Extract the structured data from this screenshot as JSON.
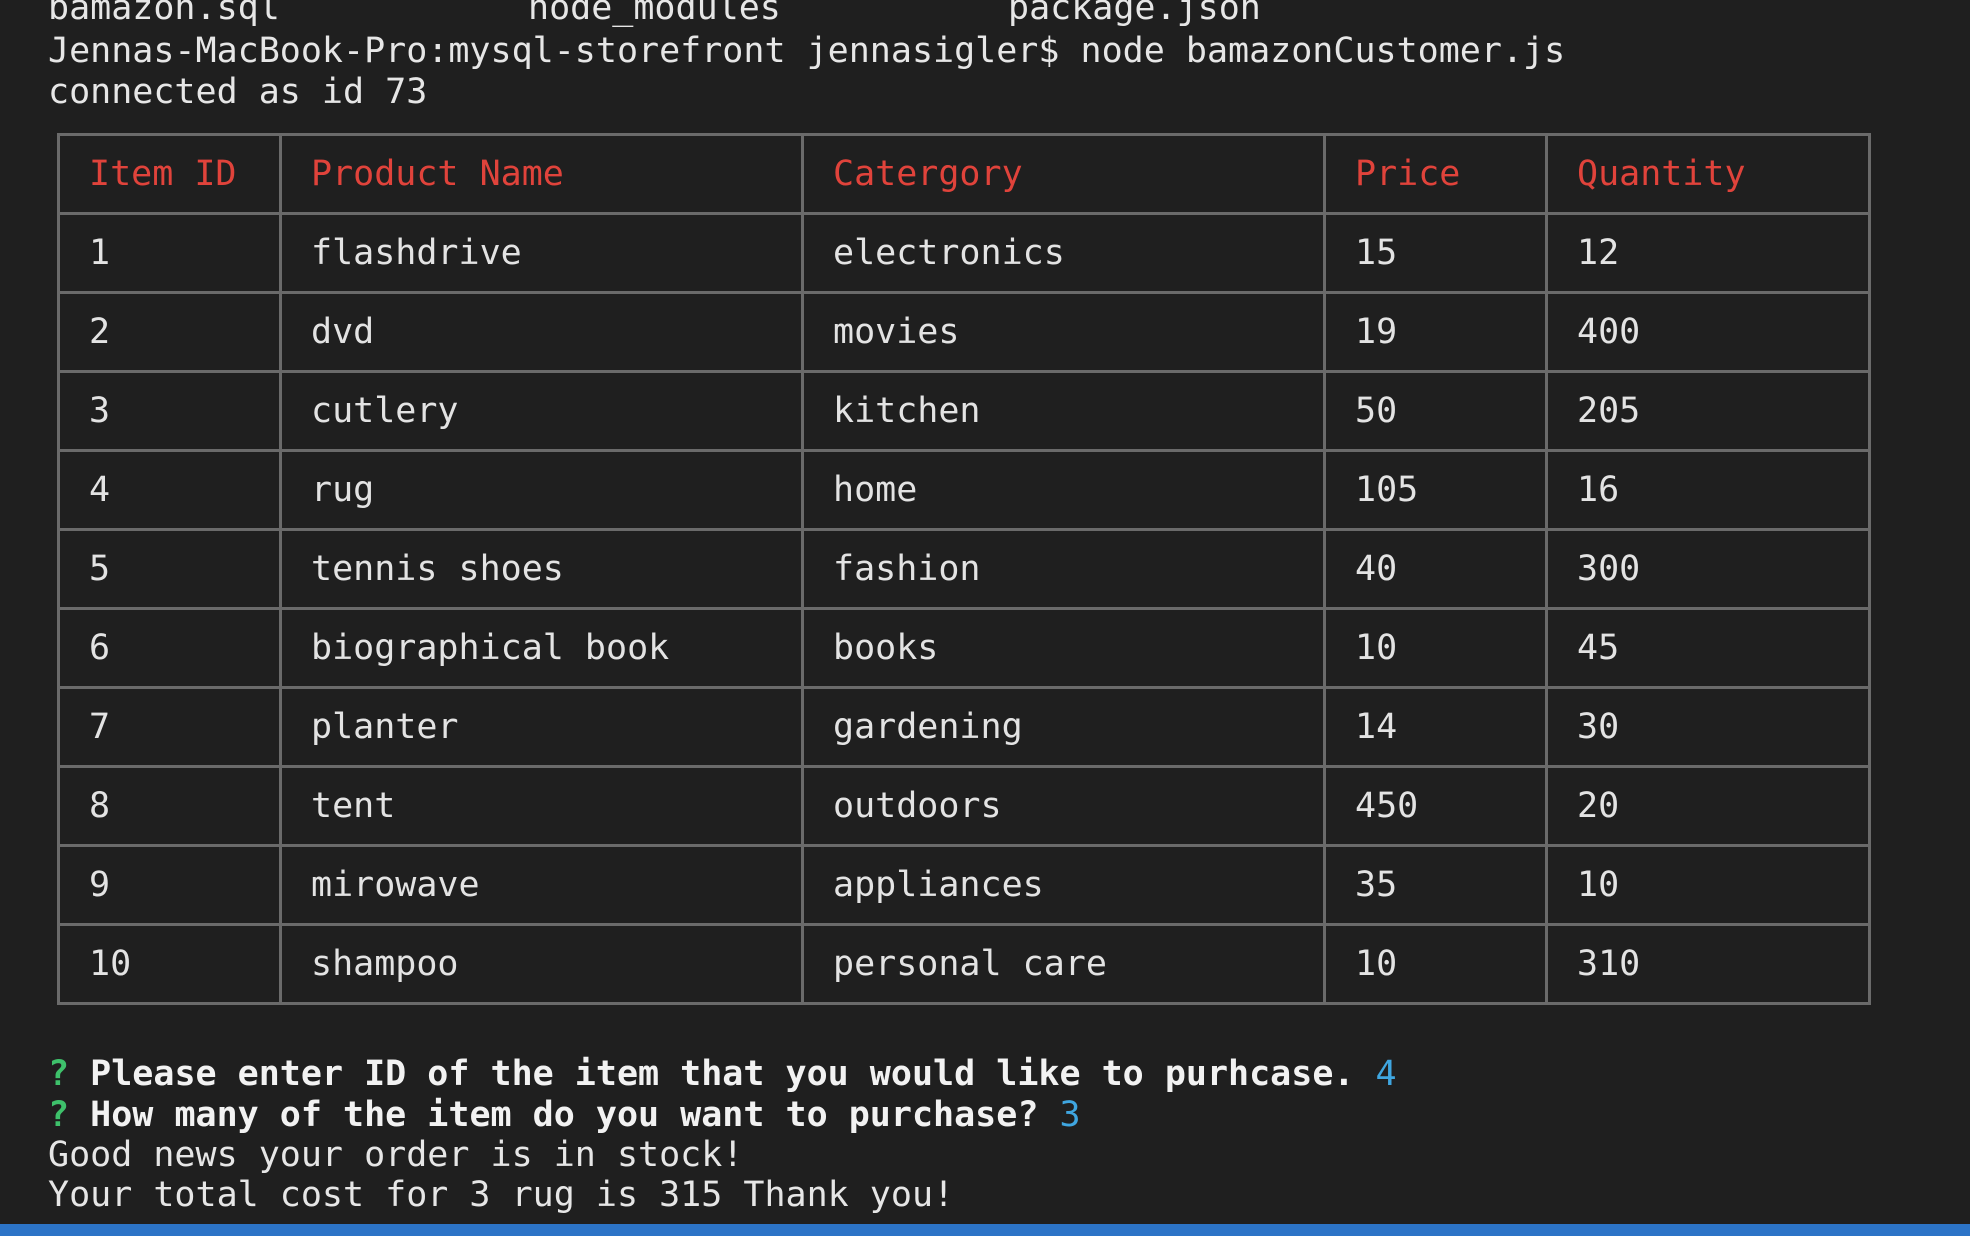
{
  "ls_output": [
    "bamazon.sql",
    "node_modules",
    "package.json"
  ],
  "command_line": "Jennas-MacBook-Pro:mysql-storefront jennasigler$ node bamazonCustomer.js",
  "connected_line": "connected as id 73",
  "table": {
    "headers": [
      "Item ID",
      "Product Name",
      "Catergory",
      "Price",
      "Quantity"
    ],
    "rows": [
      [
        "1",
        "flashdrive",
        "electronics",
        "15",
        "12"
      ],
      [
        "2",
        "dvd",
        "movies",
        "19",
        "400"
      ],
      [
        "3",
        "cutlery",
        "kitchen",
        "50",
        "205"
      ],
      [
        "4",
        "rug",
        "home",
        "105",
        "16"
      ],
      [
        "5",
        "tennis shoes",
        "fashion",
        "40",
        "300"
      ],
      [
        "6",
        "biographical book",
        "books",
        "10",
        "45"
      ],
      [
        "7",
        "planter",
        "gardening",
        "14",
        "30"
      ],
      [
        "8",
        "tent",
        "outdoors",
        "450",
        "20"
      ],
      [
        "9",
        "mirowave",
        "appliances",
        "35",
        "10"
      ],
      [
        "10",
        "shampoo",
        "personal care",
        "10",
        "310"
      ]
    ]
  },
  "prompts": [
    {
      "marker": "?",
      "question": "Please enter ID of the item that you would like to purhcase.",
      "answer": "4"
    },
    {
      "marker": "?",
      "question": "How many of the item do you want to purchase?",
      "answer": "3"
    }
  ],
  "messages": [
    "Good news your order is in stock!",
    "Your total cost for 3 rug is 315 Thank you!"
  ],
  "colors": {
    "background": "#1f1f1f",
    "header_text": "#e0433b",
    "prompt_marker": "#3ec16b",
    "answer": "#3fa6e0",
    "status_bar": "#2c74c7"
  }
}
